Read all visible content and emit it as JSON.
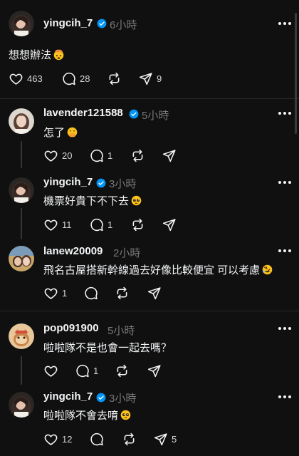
{
  "posts": [
    {
      "username": "yingcih_7",
      "verified": true,
      "time": "6小時",
      "text": "想想辦法",
      "emoji": "exploding-head",
      "likes": "463",
      "comments": "28",
      "reposts": "",
      "shares": "9"
    },
    {
      "username": "lavender121588",
      "verified": true,
      "time": "5小時",
      "text": "怎了",
      "emoji": "hand-over-mouth",
      "likes": "20",
      "comments": "1",
      "reposts": "",
      "shares": ""
    },
    {
      "username": "yingcih_7",
      "verified": true,
      "time": "3小時",
      "text": "機票好貴下不下去",
      "emoji": "pleading-face",
      "likes": "11",
      "comments": "1",
      "reposts": "",
      "shares": ""
    },
    {
      "username": "lanew20009",
      "verified": false,
      "time": "2小時",
      "text": "飛名古屋搭新幹線過去好像比較便宜 可以考慮",
      "emoji": "rolling-on-floor-laughing",
      "likes": "1",
      "comments": "",
      "reposts": "",
      "shares": ""
    },
    {
      "username": "pop091900",
      "verified": false,
      "time": "5小時",
      "text": "啦啦隊不是也會一起去嗎？",
      "emoji": "",
      "likes": "",
      "comments": "1",
      "reposts": "",
      "shares": ""
    },
    {
      "username": "yingcih_7",
      "verified": true,
      "time": "3小時",
      "text": "啦啦隊不會去唷",
      "emoji": "pleading-face",
      "likes": "12",
      "comments": "",
      "reposts": "",
      "shares": "5"
    }
  ],
  "icons": {
    "like": "heart-icon",
    "comment": "comment-bubble-icon",
    "repost": "repost-icon",
    "share": "send-icon",
    "more": "more-icon",
    "verified": "verified-badge-icon"
  },
  "colors": {
    "background": "#101010",
    "text": "#f3f5f7",
    "muted": "#777777",
    "verified": "#0095f6"
  }
}
